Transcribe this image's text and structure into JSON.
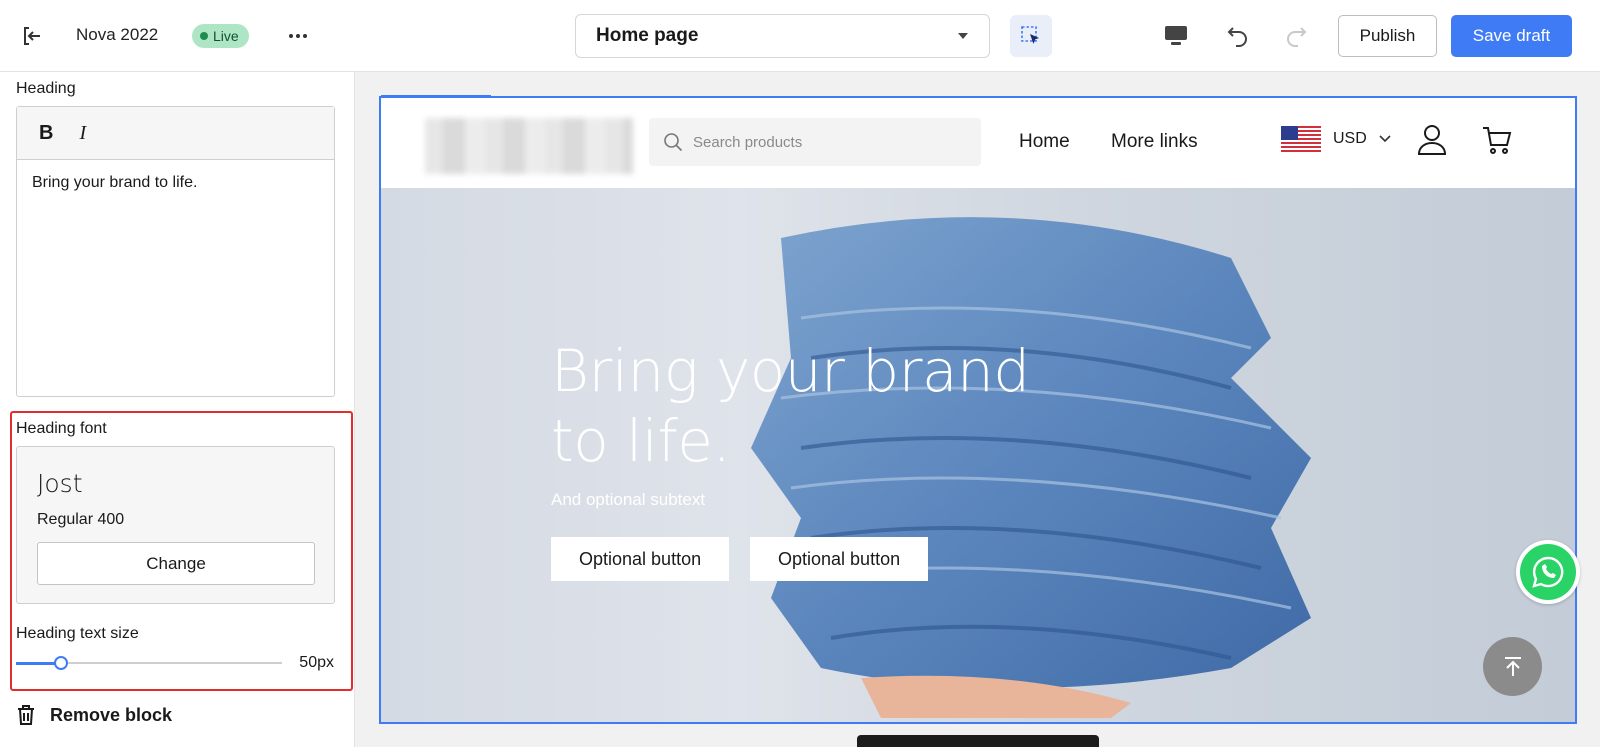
{
  "topbar": {
    "store_name": "Nova 2022",
    "status_badge": "Live",
    "page_selector": "Home page",
    "publish_label": "Publish",
    "save_draft_label": "Save draft"
  },
  "sidebar": {
    "heading_label": "Heading",
    "editor": {
      "bold_label": "B",
      "italic_label": "I",
      "content": "Bring your brand to life."
    },
    "heading_font_label": "Heading font",
    "font": {
      "name": "Jost",
      "weight": "Regular 400",
      "change_label": "Change"
    },
    "text_size_label": "Heading text size",
    "text_size_value": "50px",
    "text_size_fraction": 0.17,
    "remove_block_label": "Remove block"
  },
  "preview": {
    "search_placeholder": "Search products",
    "nav": [
      "Home",
      "More links"
    ],
    "currency": "USD",
    "hero_title": "Bring your brand to life.",
    "hero_subtext": "And optional subtext",
    "buttons": [
      "Optional button",
      "Optional button"
    ]
  },
  "colors": {
    "accent": "#3f7bf5",
    "highlight_border": "#e22d2d",
    "live_badge": "#aee6c5",
    "whatsapp": "#29d366"
  }
}
